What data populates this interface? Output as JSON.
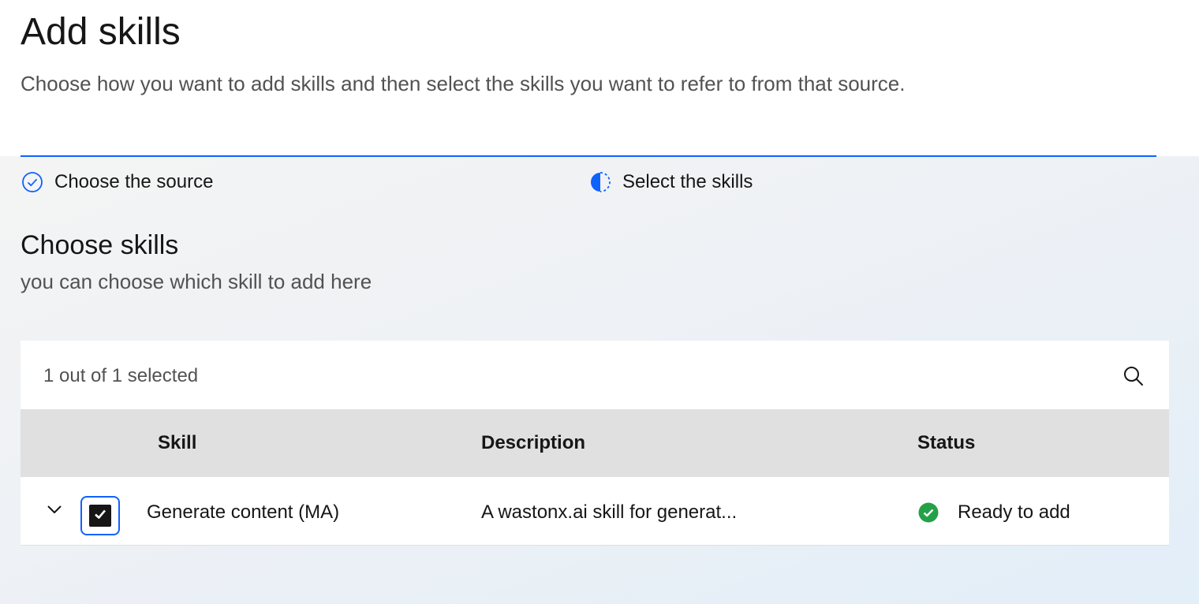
{
  "header": {
    "title": "Add skills",
    "subtitle": "Choose how you want to add skills and then select the skills you want to refer to from that source."
  },
  "progress": {
    "steps": [
      {
        "label": "Choose the source",
        "state": "complete",
        "icon": "checkmark-outline-icon"
      },
      {
        "label": "Select the skills",
        "state": "current",
        "icon": "incomplete-icon"
      }
    ]
  },
  "section": {
    "title": "Choose skills",
    "subtitle": "you can choose which skill to add here"
  },
  "table": {
    "selection_text": "1 out of 1 selected",
    "search_icon": "search-icon",
    "columns": [
      "Skill",
      "Description",
      "Status"
    ],
    "rows": [
      {
        "checked": true,
        "skill": "Generate content (MA)",
        "description": "A wastonx.ai skill for generat...",
        "status": "Ready to add",
        "status_icon": "checkmark-filled-icon"
      }
    ]
  },
  "colors": {
    "accent": "#0f62fe",
    "success": "#24a148",
    "header_row": "#e0e0e0"
  }
}
